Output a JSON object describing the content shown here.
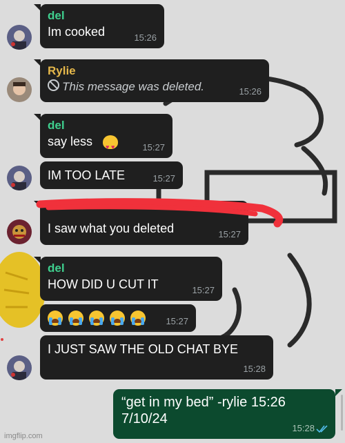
{
  "colors": {
    "bubble_in": "#1f1f1f",
    "bubble_out": "#0c4a2e",
    "sender_del": "#3fcf8e",
    "sender_rylie": "#e6b84b",
    "timestamp": "#9aa1a5",
    "read_ticks": "#53bdeb",
    "redaction": "#f0313b",
    "background": "#dcdcdc"
  },
  "messages": [
    {
      "sender": "del",
      "text": "Im cooked",
      "time": "15:26"
    },
    {
      "sender": "Rylie",
      "text": "This message was deleted.",
      "time": "15:26",
      "deleted_icon": "no-entry-icon"
    },
    {
      "sender": "del",
      "text": "say less",
      "emoji": "heart-eyes-cat-emoji",
      "time": "15:27"
    },
    {
      "text": "IM TOO LATE",
      "time": "15:27"
    },
    {
      "text": "I saw what you deleted",
      "time": "15:27",
      "redacted_sender": true
    },
    {
      "sender": "del",
      "text": "HOW DID U CUT IT",
      "time": "15:27"
    },
    {
      "emoji_count": 5,
      "emoji": "loudly-crying-face-emoji",
      "time": "15:27"
    },
    {
      "text": "I JUST SAW THE OLD CHAT BYE",
      "time": "15:28"
    },
    {
      "outgoing": true,
      "line1": "“get in my bed” -rylie 15:26",
      "line2": "7/10/24",
      "time": "15:28",
      "status_icon": "double-check-read-icon"
    }
  ],
  "watermark": "imgflip.com"
}
